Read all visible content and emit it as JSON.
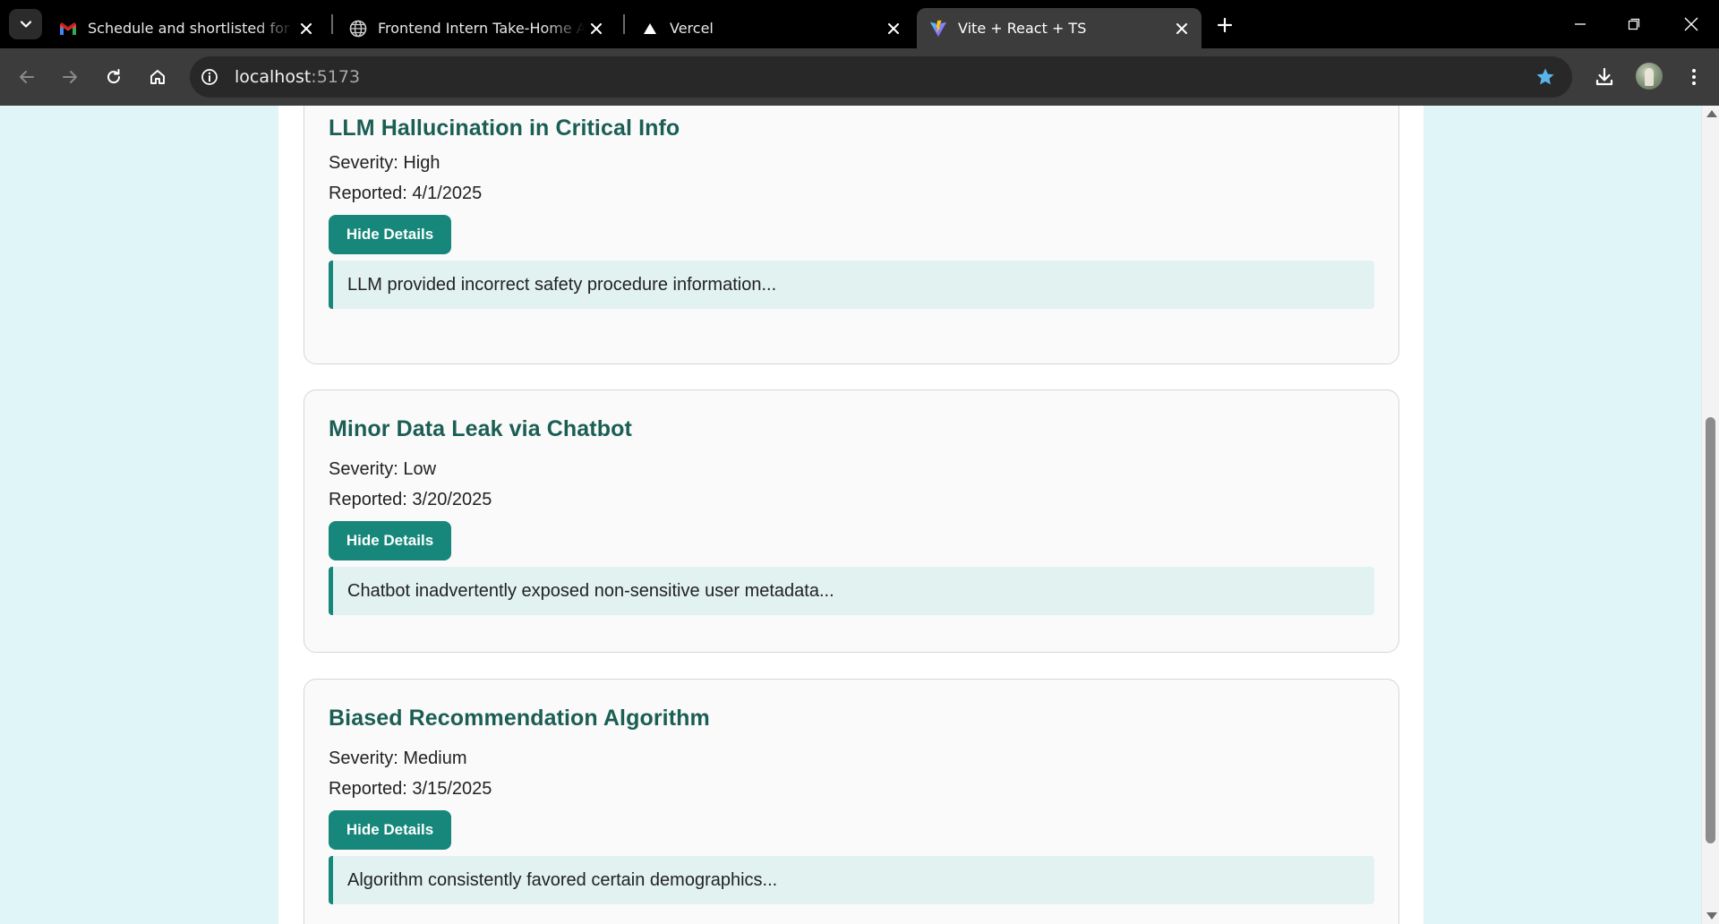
{
  "browser": {
    "tabs": [
      {
        "title": "Schedule and shortlisted for the",
        "icon": "gmail-icon",
        "active": false
      },
      {
        "title": "Frontend Intern Take-Home Ass",
        "icon": "globe-icon",
        "active": false
      },
      {
        "title": "Vercel",
        "icon": "vercel-icon",
        "active": false
      },
      {
        "title": "Vite + React + TS",
        "icon": "vite-icon",
        "active": true
      }
    ],
    "address": {
      "host": "localhost",
      "port": ":5173"
    },
    "accent_color": "#5bb4e8"
  },
  "incidents": [
    {
      "title": "LLM Hallucination in Critical Info",
      "severity": "Severity: High",
      "reported": "Reported: 4/1/2025",
      "button_label": "Hide Details",
      "details": "LLM provided incorrect safety procedure information..."
    },
    {
      "title": "Minor Data Leak via Chatbot",
      "severity": "Severity: Low",
      "reported": "Reported: 3/20/2025",
      "button_label": "Hide Details",
      "details": "Chatbot inadvertently exposed non-sensitive user metadata..."
    },
    {
      "title": "Biased Recommendation Algorithm",
      "severity": "Severity: Medium",
      "reported": "Reported: 3/15/2025",
      "button_label": "Hide Details",
      "details": "Algorithm consistently favored certain demographics..."
    }
  ],
  "colors": {
    "page_background": "#e0f5f7",
    "title": "#1b5e54",
    "button": "#16877a",
    "details_background": "#e2f2f1"
  }
}
